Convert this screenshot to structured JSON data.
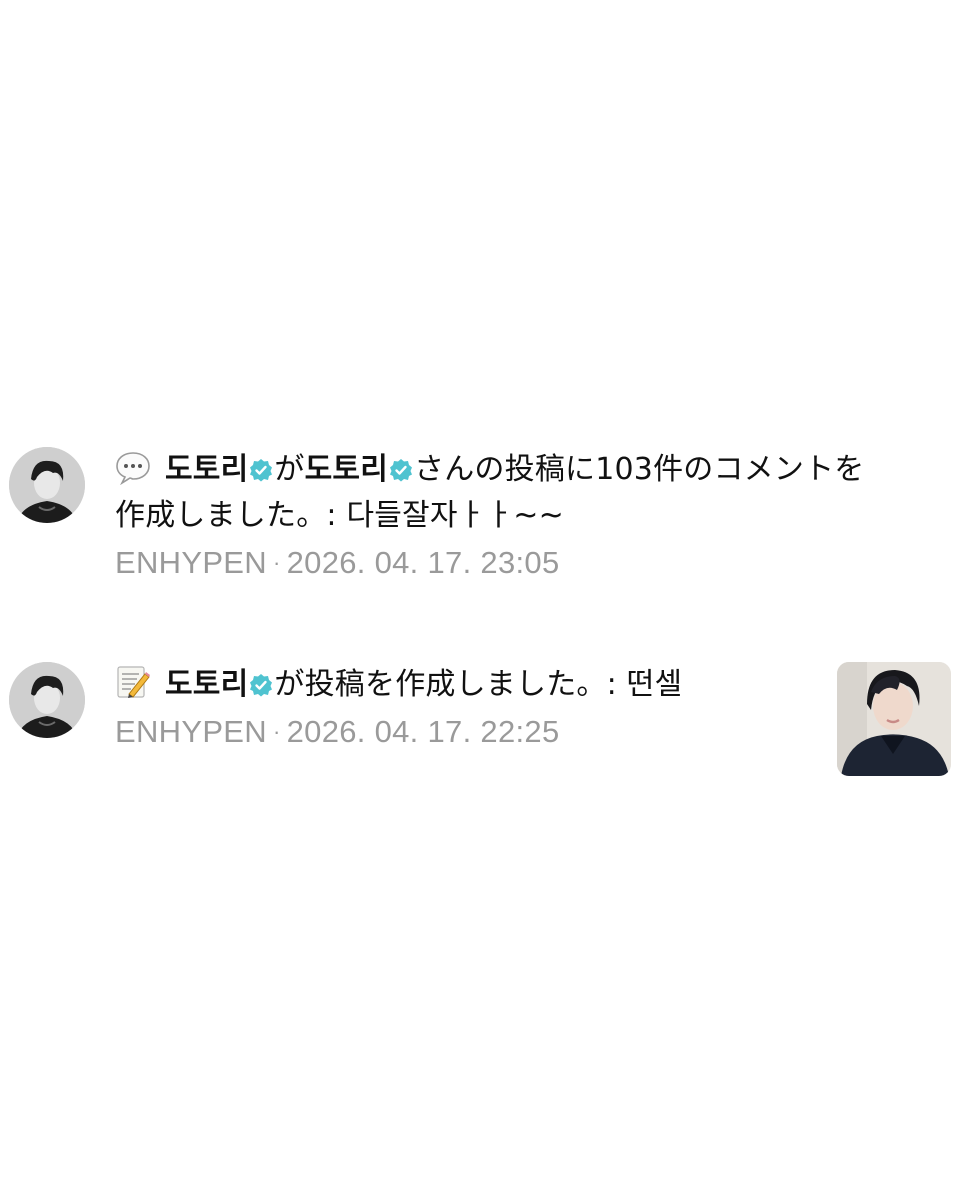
{
  "notifications": [
    {
      "icon": "speech-bubble-icon",
      "line1": {
        "name1": "도토리",
        "connector": "が",
        "name2": "도토리",
        "text": "さんの投稿に103件のコメントを"
      },
      "line2": "作成しました。: 다들잘자ㅏㅏ~~",
      "source": "ENHYPEN",
      "separator": "·",
      "timestamp": "2026. 04. 17. 23:05"
    },
    {
      "icon": "memo-icon",
      "line1": {
        "name1": "도토리",
        "text": "が投稿を作成しました。: 떤셀"
      },
      "source": "ENHYPEN",
      "separator": "·",
      "timestamp": "2026. 04. 17. 22:25"
    }
  ],
  "colors": {
    "verified_badge": "#4fc3d0",
    "meta_text": "#9a9a9a"
  }
}
